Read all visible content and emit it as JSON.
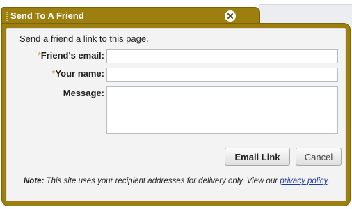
{
  "dialog": {
    "title": "Send To A Friend",
    "intro": "Send a friend a link to this page.",
    "required_marker": "*"
  },
  "form": {
    "friend_email_label": "Friend's email:",
    "friend_email_value": "",
    "your_name_label": "Your name:",
    "your_name_value": "",
    "message_label": "Message:",
    "message_value": ""
  },
  "buttons": {
    "email_link": "Email Link",
    "cancel": "Cancel"
  },
  "note": {
    "prefix": "Note:",
    "text": " This site uses your recipient addresses for delivery only. View our ",
    "link_text": "privacy policy",
    "suffix": "."
  },
  "colors": {
    "frame": "#9d7f10",
    "inner_bg": "#f3f3f3",
    "required_asterisk": "#c49a1d",
    "link": "#1f3f9e"
  },
  "icons": {
    "close": "close-icon",
    "grip": "drag-grip-icon"
  }
}
